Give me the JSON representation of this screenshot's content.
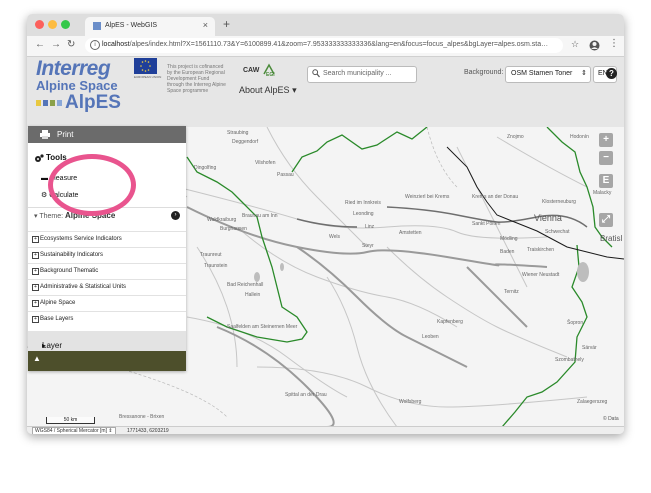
{
  "browser": {
    "tab_title": "AlpES - WebGIS",
    "url_host": "localhost",
    "url_rest": "/alpes/index.html?X=1561110.73&Y=6100899.41&zoom=7.953333333333336&lang=en&focus=focus_alpes&bgLayer=alpes.osm.sta…"
  },
  "header": {
    "logo_main": "Interreg",
    "logo_sub": "Alpine Space",
    "logo_project": "AlpES",
    "eu_caption": "EUROPEAN UNION",
    "cofinance_text": "This project is cofinanced by the European Regional Development Fund through the Interreg Alpine Space programme",
    "partner_logo": "CAW EGI",
    "about_label": "About AlpES",
    "search_placeholder": "Search municipality ...",
    "background_label": "Background:",
    "background_value": "OSM Stamen Toner",
    "language": "EN"
  },
  "panel": {
    "print_label": "Print",
    "tools_heading": "Tools",
    "measure_label": "Measure",
    "calculate_label": "Calculate",
    "theme_prefix": "Theme:",
    "theme_value": "Alpine Space",
    "layers": [
      "Ecosystems Service Indicators",
      "Sustainability Indicators",
      "Background Thematic",
      "Administrative & Statistical Units",
      "Alpine Space",
      "Base Layers"
    ],
    "layer_properties": "Layer properties"
  },
  "map": {
    "labels": [
      "Straubing",
      "Deggendorf",
      "Dingolfing",
      "Vilshofen",
      "Passau",
      "Braunau am Inn",
      "Ried im Innkreis",
      "Wels",
      "Linz",
      "Leonding",
      "Steyr",
      "Amstetten",
      "Weinzierl bei Krems",
      "Krems an der Donau",
      "Sankt Pölten",
      "Mödling",
      "Baden",
      "Traiskirchen",
      "Klosterneuburg",
      "Schwechat",
      "Znojmo",
      "Hodonín",
      "Malacky",
      "Wiener Neustadt",
      "Ternitz",
      "Kapfenberg",
      "Leoben",
      "Bad Reichenhall",
      "Hallein",
      "Traunreut",
      "Traunstein",
      "Burghausen",
      "Saalfelden am Steinernen Meer",
      "Spittal an der Drau",
      "Wolfsberg",
      "Bressanone - Brixen",
      "Šopron",
      "Szombathely",
      "Sárvár",
      "Zalaegerszeg",
      "Waldkraiburg"
    ],
    "city_vienna": "Vienna",
    "city_bratislava": "Bratisl",
    "scale_label": "50 km",
    "controls": [
      "+",
      "−",
      "E",
      "⤢"
    ],
    "attribution": "© Data"
  },
  "status": {
    "projection": "WGS84 / Spherical Mercator [m]",
    "coordinates": "1771433, 6203219"
  },
  "colors": {
    "border_green": "#2a8a2a",
    "panel_olive": "#4d4f2b",
    "highlight_pink": "#e9548e",
    "brand_blue": "#5575b8"
  }
}
